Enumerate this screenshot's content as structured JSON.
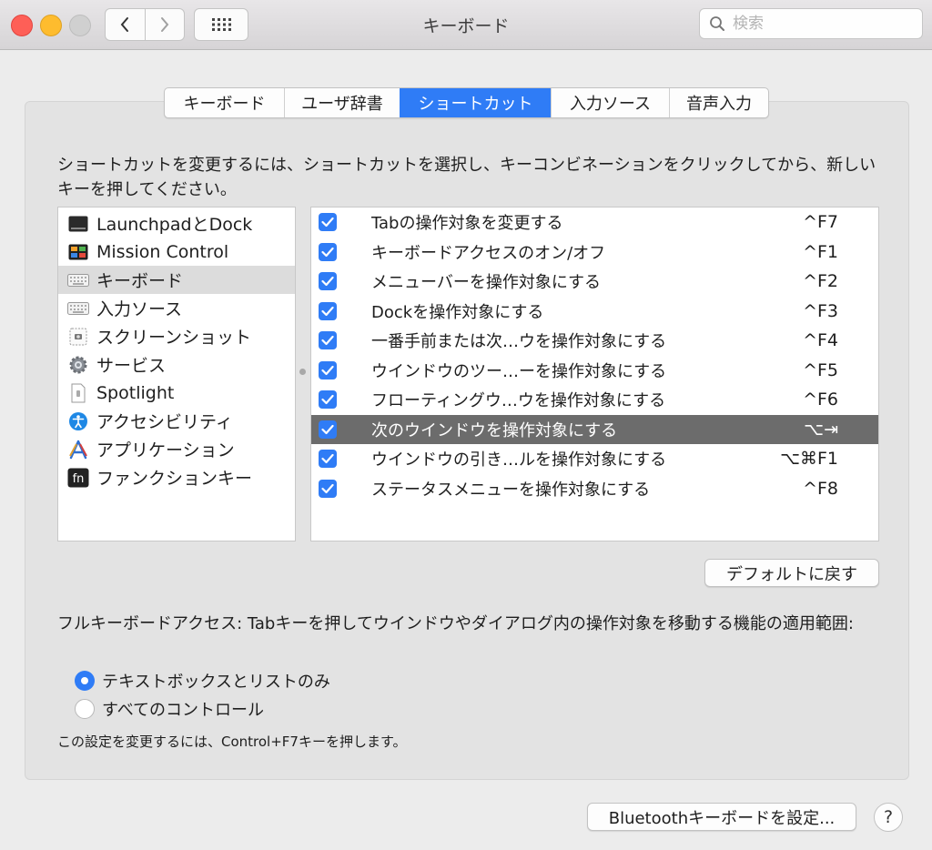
{
  "window": {
    "title": "キーボード"
  },
  "toolbar": {
    "search_placeholder": "検索"
  },
  "tabs": [
    {
      "label": "キーボード",
      "active": false
    },
    {
      "label": "ユーザ辞書",
      "active": false
    },
    {
      "label": "ショートカット",
      "active": true
    },
    {
      "label": "入力ソース",
      "active": false
    },
    {
      "label": "音声入力",
      "active": false
    }
  ],
  "description": "ショートカットを変更するには、ショートカットを選択し、キーコンビネーションをクリックしてから、新しいキーを押してください。",
  "categories": [
    {
      "label": "LaunchpadとDock",
      "icon": "launchpad-dock-icon"
    },
    {
      "label": "Mission Control",
      "icon": "mission-control-icon"
    },
    {
      "label": "キーボード",
      "icon": "keyboard-icon",
      "selected": true
    },
    {
      "label": "入力ソース",
      "icon": "input-sources-icon"
    },
    {
      "label": "スクリーンショット",
      "icon": "screenshot-icon"
    },
    {
      "label": "サービス",
      "icon": "services-gear-icon"
    },
    {
      "label": "Spotlight",
      "icon": "spotlight-icon"
    },
    {
      "label": "アクセシビリティ",
      "icon": "accessibility-icon"
    },
    {
      "label": "アプリケーション",
      "icon": "applications-icon"
    },
    {
      "label": "ファンクションキー",
      "icon": "fn-key-icon"
    }
  ],
  "shortcuts": [
    {
      "name": "Tabの操作対象を変更する",
      "key": "^F7",
      "checked": true
    },
    {
      "name": "キーボードアクセスのオン/オフ",
      "key": "^F1",
      "checked": true
    },
    {
      "name": "メニューバーを操作対象にする",
      "key": "^F2",
      "checked": true
    },
    {
      "name": "Dockを操作対象にする",
      "key": "^F3",
      "checked": true
    },
    {
      "name": "一番手前または次…ウを操作対象にする",
      "key": "^F4",
      "checked": true
    },
    {
      "name": "ウインドウのツー…ーを操作対象にする",
      "key": "^F5",
      "checked": true
    },
    {
      "name": "フローティングウ…ウを操作対象にする",
      "key": "^F6",
      "checked": true
    },
    {
      "name": "次のウインドウを操作対象にする",
      "key": "⌥⇥",
      "checked": true,
      "selected": true
    },
    {
      "name": "ウインドウの引き…ルを操作対象にする",
      "key": "⌥⌘F1",
      "checked": true
    },
    {
      "name": "ステータスメニューを操作対象にする",
      "key": "^F8",
      "checked": true
    }
  ],
  "buttons": {
    "restore_defaults": "デフォルトに戻す",
    "bluetooth": "Bluetoothキーボードを設定...",
    "help": "?"
  },
  "full_keyboard_access": {
    "label": "フルキーボードアクセス: Tabキーを押してウインドウやダイアログ内の操作対象を移動する機能の適用範囲:",
    "options": [
      {
        "label": "テキストボックスとリストのみ",
        "selected": true
      },
      {
        "label": "すべてのコントロール",
        "selected": false
      }
    ],
    "note": "この設定を変更するには、Control+F7キーを押します。"
  },
  "colors": {
    "accent": "#2f7cf6",
    "selected_row": "#6c6c6c"
  }
}
